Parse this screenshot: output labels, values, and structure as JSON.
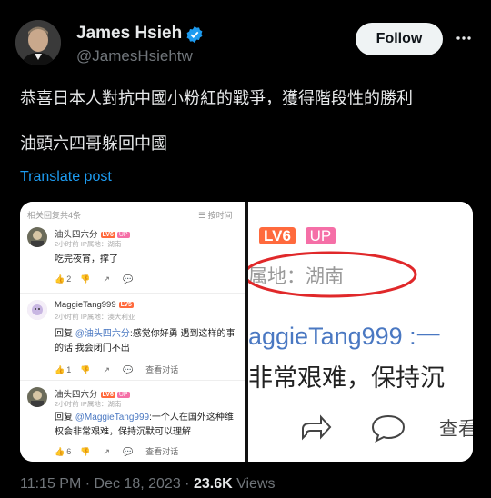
{
  "header": {
    "name": "James Hsieh",
    "handle": "@JamesHsiehtw",
    "follow_label": "Follow"
  },
  "tweet": {
    "line1": "恭喜日本人對抗中國小粉紅的戰爭，獲得階段性的勝利",
    "line2": "油頭六四哥躲回中國",
    "translate": "Translate post"
  },
  "screenshot": {
    "header_left": "相关回复共4条",
    "header_right": "☰ 按时间",
    "comments": [
      {
        "name": "油头四六分",
        "lv": "LV6",
        "up": "UP",
        "meta": "2小时前  IP属地：湖南",
        "text": "吃完夜宵，撑了",
        "likes": "2"
      },
      {
        "name": "MaggieTang999",
        "lv": "LV5",
        "meta": "2小时前  IP属地：澳大利亚",
        "reply_prefix": "回复",
        "mention": "@油头四六分",
        "text": ":感觉你好勇 遇到这样的事的话 我会闭门不出",
        "likes": "1",
        "view_dialog": "查看对话"
      },
      {
        "name": "油头四六分",
        "lv": "LV6",
        "up": "UP",
        "meta": "2小时前  IP属地：湖南",
        "reply_prefix": "回复",
        "mention": "@MaggieTang999",
        "text": ":一个人在国外这种维权会非常艰难，保持沉默可以理解",
        "likes": "6",
        "view_dialog": "查看对话"
      }
    ],
    "zoom": {
      "lv": "LV6",
      "up": "UP",
      "ip_text": "属地：湖南",
      "name_text": "aggieTang999 :一",
      "body_text": "非常艰难，保持沉",
      "view_text": "查看"
    }
  },
  "footer": {
    "time": "11:15 PM",
    "date": "Dec 18, 2023",
    "views_count": "23.6K",
    "views_label": "Views"
  },
  "colors": {
    "background": "#000000",
    "link": "#1d9bf0",
    "verified": "#1d9bf0",
    "circle": "#e0282a"
  }
}
